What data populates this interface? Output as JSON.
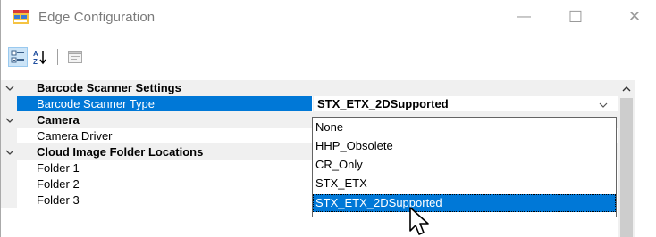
{
  "window": {
    "title": "Edge Configuration",
    "controls": {
      "minimize": "—",
      "maximize": "☐",
      "close": "✕"
    }
  },
  "toolbar": {
    "categorized_icon": "categorized-icon",
    "alphabetical_icon": "alphabetical-sort-icon",
    "property_pages_icon": "property-pages-icon"
  },
  "grid": {
    "categories": [
      {
        "label": "Barcode Scanner Settings",
        "properties": [
          {
            "name": "Barcode Scanner Type",
            "value": "STX_ETX_2DSupported",
            "selected": true
          }
        ]
      },
      {
        "label": "Camera",
        "properties": [
          {
            "name": "Camera Driver",
            "value": ""
          }
        ]
      },
      {
        "label": "Cloud Image Folder Locations",
        "properties": [
          {
            "name": "Folder 1",
            "value": ""
          },
          {
            "name": "Folder 2",
            "value": ""
          },
          {
            "name": "Folder 3",
            "value": ""
          }
        ]
      }
    ]
  },
  "dropdown": {
    "options": [
      "None",
      "HHP_Obsolete",
      "CR_Only",
      "STX_ETX",
      "STX_ETX_2DSupported"
    ],
    "selected_index": 4
  },
  "colors": {
    "selection": "#0078d7",
    "category_bg": "#f0f0f0",
    "title_text": "#7a7a7a"
  }
}
